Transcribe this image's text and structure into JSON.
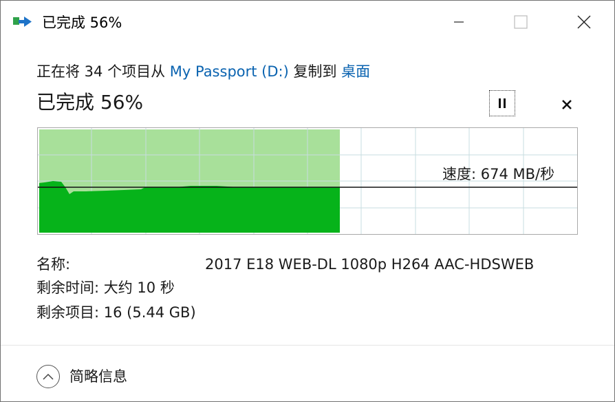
{
  "window": {
    "title": "已完成 56%",
    "controls": {
      "minimize_icon": "minimize-icon",
      "maximize_icon": "maximize-icon",
      "close_icon": "close-icon"
    }
  },
  "copy": {
    "prefix": "正在将 34 个项目从 ",
    "source": "My Passport (D:)",
    "middle": " 复制到 ",
    "destination": "桌面"
  },
  "progress": {
    "title": "已完成 56%",
    "percent": 56
  },
  "speed": {
    "label": "速度: 674 MB/秒",
    "value_mb_per_s": 674
  },
  "details": {
    "name_label": "名称:",
    "name_value": "2017 E18 WEB-DL 1080p H264 AAC-HDSWEB",
    "time_label": "剩余时间: 大约 10 秒",
    "items_label": "剩余项目: 16 (5.44 GB)"
  },
  "footer": {
    "less_details": "简略信息"
  },
  "colors": {
    "link": "#0a63b0",
    "progress_light": "#a8e09a",
    "progress_dark": "#06b31a",
    "grid": "#c7dde0"
  }
}
